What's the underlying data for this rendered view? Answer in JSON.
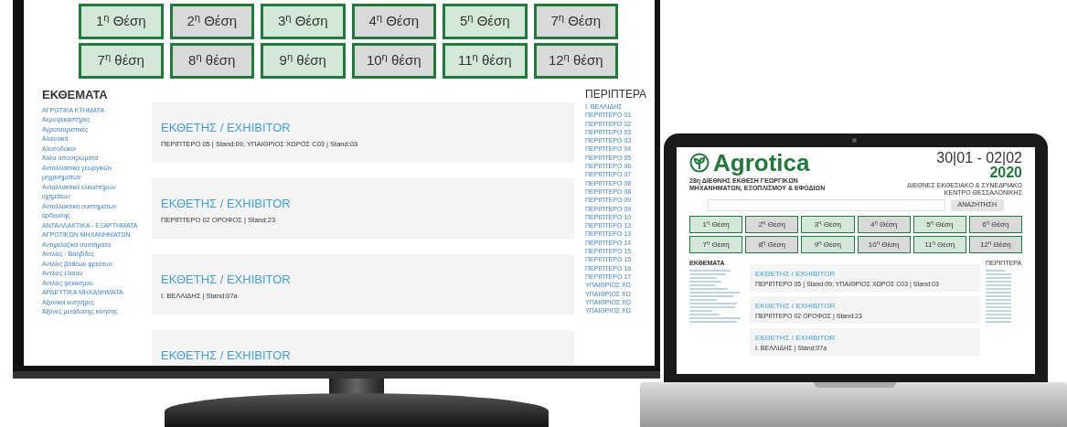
{
  "monitor": {
    "position_buttons": [
      {
        "label": "1$^{η}$ Θέση",
        "color": "#d3e8d8"
      },
      {
        "label": "2$^{η}$ Θέση",
        "color": "#d9d9d9"
      },
      {
        "label": "3$^{η}$ Θέση",
        "color": "#d3e8d8"
      },
      {
        "label": "4$^{η}$ Θέση",
        "color": "#d9d9d9"
      },
      {
        "label": "5$^{η}$ Θέση",
        "color": "#d3e8d8"
      },
      {
        "label": "7$^{η}$ Θέση",
        "color": "#d9d9d9"
      },
      {
        "label": "7$^{η}$ θέση",
        "color": "#d3e8d8"
      },
      {
        "label": "8$^{η}$ θέση",
        "color": "#d9d9d9"
      },
      {
        "label": "9$^{η}$ θέση",
        "color": "#d3e8d8"
      },
      {
        "label": "10$^{η}$ θέση",
        "color": "#d9d9d9"
      },
      {
        "label": "11$^{η}$ θέση",
        "color": "#d3e8d8"
      },
      {
        "label": "12$^{η}$ θέση",
        "color": "#d9d9d9"
      }
    ],
    "exhibits": {
      "heading": "ΕΚΘΕΜΑΤΑ",
      "items": [
        "ΑΓΡΟΤΙΚΑ ΚΤΗΜΑΤΑ",
        "Αεροψεκαστήρες",
        "Αγροτουριστικές",
        "Αλιευτικά",
        "Αλυσοδοκοί",
        "Άλλα υποστρώματα",
        "Ανταλλακτικά γεωργικών μηχανημάτων",
        "Ανταλλακτικά ελκυστήρων οχημάτων",
        "Ανταλλακτικά συστημάτων άρδευσης",
        "ΑΝΤΑΛΛΑΚΤΙΚΑ - ΕΞΑΡΤΗΜΑΤΑ ΑΓΡΟΤΙΚΩΝ ΜΗΧΑΝΗΜΑΤΩΝ",
        "Αντιχαλαζικά συστήματα",
        "Αντλίες - Βαλβίδες",
        "Αντλίες βαθέων φρεάτων",
        "Αντλίες ελαίου",
        "Αντλίες ψεκασμού",
        "ΑΡΔΕΥΤΙΚΑ ΜΗΧΑΝΗΜΑΤΑ",
        "Αξονικοί κινητήρες",
        "Άξονες μετάδοσης κίνησης"
      ]
    },
    "exhibitors": [
      {
        "title": "ΕΚΘΕΤΗΣ / EXHIBITOR",
        "location": "ΠΕΡΙΠΤΕΡΟ 05 | Stand:09, ΥΠΑΙΘΡΙΟΣ ΧΩΡΟΣ C03 | Stand:03"
      },
      {
        "title": "ΕΚΘΕΤΗΣ / EXHIBITOR",
        "location": "ΠΕΡΙΠΤΕΡΟ 02 ΟΡΟΦΟΣ | Stand:23"
      },
      {
        "title": "ΕΚΘΕΤΗΣ / EXHIBITOR",
        "location": "Ι. ΒΕΛΛΙΔΗΣ | Stand:07a"
      },
      {
        "title": "ΕΚΘΕΤΗΣ / EXHIBITOR"
      }
    ],
    "pavilions": {
      "heading": "ΠΕΡΙΠΤΕΡΑ",
      "items": [
        "Ι. ΒΕΛΛΙΔΗΣ",
        "ΠΕΡΙΠΤΕΡΟ 01",
        "ΠΕΡΙΠΤΕΡΟ 02",
        "ΠΕΡΙΠΤΕΡΟ 03",
        "ΠΕΡΙΠΤΕΡΟ 03",
        "ΠΕΡΙΠΤΕΡΟ 04",
        "ΠΕΡΙΠΤΕΡΟ 05",
        "ΠΕΡΙΠΤΕΡΟ 06",
        "ΠΕΡΙΠΤΕΡΟ 07",
        "ΠΕΡΙΠΤΕΡΟ 08",
        "ΠΕΡΙΠΤΕΡΟ 08",
        "ΠΕΡΙΠΤΕΡΟ 09",
        "ΠΕΡΙΠΤΕΡΟ 09",
        "ΠΕΡΙΠΤΕΡΟ 10",
        "ΠΕΡΙΠΤΕΡΟ 13",
        "ΠΕΡΙΠΤΕΡΟ 13",
        "ΠΕΡΙΠΤΕΡΟ 14",
        "ΠΕΡΙΠΤΕΡΟ 15",
        "ΠΕΡΙΠΤΕΡΟ 15",
        "ΠΕΡΙΠΤΕΡΟ 16",
        "ΠΕΡΙΠΤΕΡΟ 17",
        "ΥΠΑΙΘΡΙΟΣ ΧΩ",
        "ΥΠΑΙΘΡΙΟΣ ΧΩ",
        "ΥΠΑΙΘΡΙΟΣ ΧΩ",
        "ΥΠΑΙΘΡΙΟΣ ΧΩ"
      ]
    }
  },
  "laptop": {
    "logo": "Agrotica",
    "dates": "30|01 - 02|02",
    "year": "2020",
    "subtitle": "28η ΔΙΕΘΝΗΣ ΕΚΘΕΣΗ ΓΕΩΡΓΙΚΩΝ ΜΗΧΑΝΗΜΑΤΩΝ, ΕΞΟΠΛΙΣΜΟΥ & ΕΦΟΔΙΩΝ",
    "venue": "ΔΙΕΘΝΕΣ ΕΚΘΕΣΙΑΚΟ & ΣΥΝΕΔΡΙΑΚΟ ΚΕΝΤΡΟ ΘΕΣΣΑΛΟΝΙΚΗΣ",
    "search_button": "ΑΝΑΖΗΤΗΣΗ",
    "position_buttons": [
      {
        "label": "1$^{η}$ Θέση",
        "color": "#d3e8d8"
      },
      {
        "label": "2$^{η}$ Θέση",
        "color": "#d9d9d9"
      },
      {
        "label": "3$^{η}$ Θέση",
        "color": "#d3e8d8"
      },
      {
        "label": "4$^{η}$ Θέση",
        "color": "#d9d9d9"
      },
      {
        "label": "5$^{η}$ Θέση",
        "color": "#d3e8d8"
      },
      {
        "label": "6$^{η}$ Θέση",
        "color": "#d9d9d9"
      },
      {
        "label": "7$^{η}$ Θέση",
        "color": "#d3e8d8"
      },
      {
        "label": "8$^{η}$ Θέση",
        "color": "#d9d9d9"
      },
      {
        "label": "9$^{η}$ Θέση",
        "color": "#d3e8d8"
      },
      {
        "label": "10$^{η}$ Θέση",
        "color": "#d9d9d9"
      },
      {
        "label": "11$^{η}$ Θέση",
        "color": "#d3e8d8"
      },
      {
        "label": "12$^{η}$ Θέση",
        "color": "#d9d9d9"
      }
    ],
    "exhibits_heading": "ΕΚΘΕΜΑΤΑ",
    "exhibitors": [
      {
        "title": "ΕΚΘΕΤΗΣ / EXHIBITOR",
        "location": "ΠΕΡΙΠΤΕΡΟ 05 | Stand:09, ΥΠΑΙΘΡΙΟΣ ΧΩΡΟΣ C03 | Stand:03"
      },
      {
        "title": "ΕΚΘΕΤΗΣ / EXHIBITOR",
        "location": "ΠΕΡΙΠΤΕΡΟ 02 ΟΡΟΦΟΣ | Stand:23"
      },
      {
        "title": "ΕΚΘΕΤΗΣ / EXHIBITOR",
        "location": "Ι. ΒΕΛΛΙΔΗΣ | Stand:07a"
      }
    ],
    "pavilions_heading": "ΠΕΡΙΠΤΕΡΑ"
  }
}
